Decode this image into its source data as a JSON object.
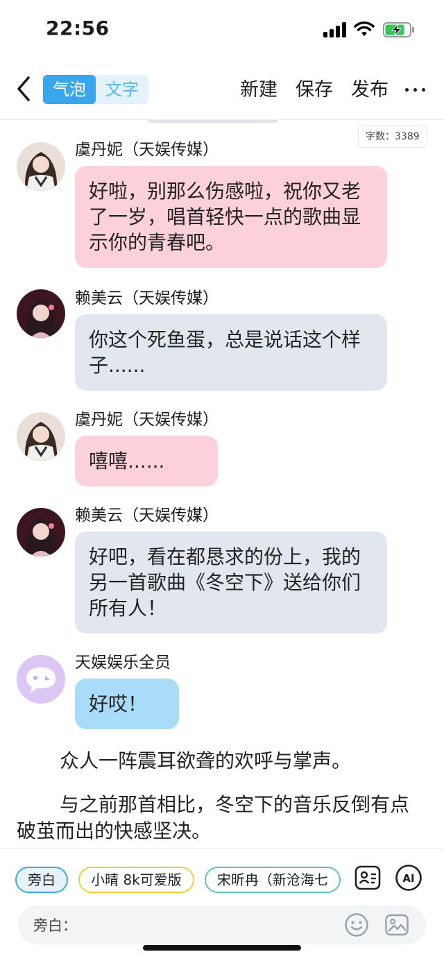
{
  "status": {
    "time": "22:56"
  },
  "nav": {
    "seg_bubble": "气泡",
    "seg_text": "文字",
    "new_label": "新建",
    "save_label": "保存",
    "publish_label": "发布"
  },
  "word_count": "字数：3389",
  "messages": [
    {
      "sender": "虞丹妮（天娱传媒）",
      "text": "好啦，别那么伤感啦，祝你又老了一岁，唱首轻快一点的歌曲显示你的青春吧。",
      "style": "pink"
    },
    {
      "sender": "赖美云（天娱传媒）",
      "text": "你这个死鱼蛋，总是说话这个样子......",
      "style": "gray"
    },
    {
      "sender": "虞丹妮（天娱传媒）",
      "text": "嘻嘻......",
      "style": "pink"
    },
    {
      "sender": "赖美云（天娱传媒）",
      "text": "好吧，看在都恳求的份上，我的另一首歌曲《冬空下》送给你们所有人！",
      "style": "gray"
    },
    {
      "sender": "天娱娱乐全员",
      "text": "好哎！",
      "style": "blue"
    }
  ],
  "narration": [
    "众人一阵震耳欲聋的欢呼与掌声。",
    "与之前那首相比，冬空下的音乐反倒有点破茧而出的快感坚决。"
  ],
  "bottom": {
    "chips": [
      "旁白",
      "小晴 8k可爱版",
      "宋昕冉（新沧海七"
    ],
    "ai_label": "AI",
    "input_placeholder": "旁白："
  },
  "colors": {
    "accent": "#3aa6ee",
    "pink_bubble": "#fdd1dc",
    "gray_bubble": "#e2e6ee",
    "blue_bubble": "#a9dcf9"
  }
}
